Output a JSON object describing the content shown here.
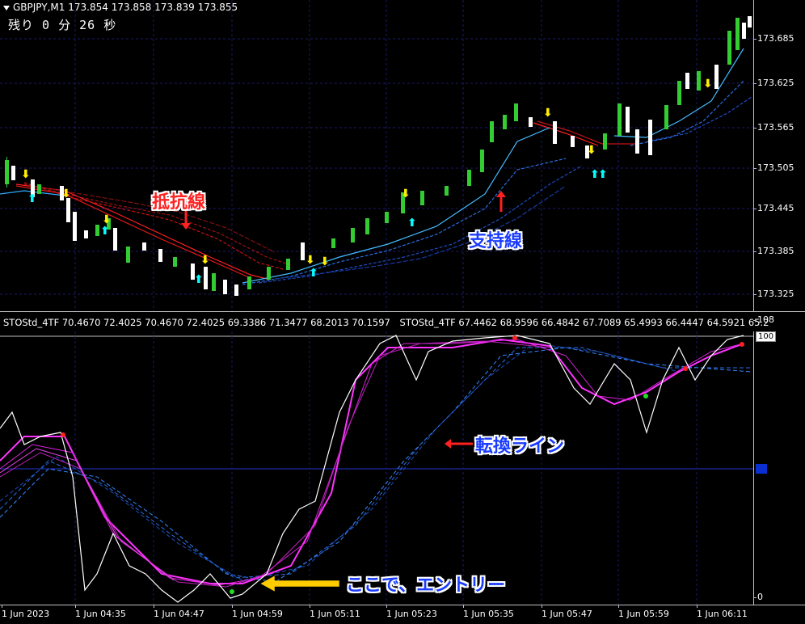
{
  "header": {
    "symbol": "GBPJPY,M1",
    "ohlc": "173.854 173.858 173.839 173.855",
    "timer": "残り 0 分 26 秒"
  },
  "price_axis": [
    "173.685",
    "173.625",
    "173.565",
    "173.505",
    "173.445",
    "173.385",
    "173.325"
  ],
  "sub_header": {
    "ind1": "STOStd_4TF 70.4670 72.4025 70.4670 72.4025 69.3386 71.3477 68.2013 70.1597",
    "ind2": "STOStd_4TF 67.4462 68.9596 66.4842 67.7089 65.4993 66.4447 64.5921 65.2"
  },
  "sub_axis": {
    "top_small": "108",
    "max": "100",
    "min": "0"
  },
  "time_axis": [
    "1 Jun 2023",
    "1 Jun 04:35",
    "1 Jun 04:47",
    "1 Jun 04:59",
    "1 Jun 05:11",
    "1 Jun 05:23",
    "1 Jun 05:35",
    "1 Jun 05:47",
    "1 Jun 05:59",
    "1 Jun 06:11"
  ],
  "annotations": {
    "resistance": "抵抗線",
    "support": "支持線",
    "turn_line": "転換ライン",
    "entry": "ここで、エントリー"
  },
  "colors": {
    "bull": "#33cc33",
    "bear": "#ffffff",
    "resistance": "#ff3030",
    "support": "#3399ff",
    "stoch_main": "#ff33ff",
    "arrow_up": "#00ffff",
    "arrow_down": "#ffee00"
  }
}
